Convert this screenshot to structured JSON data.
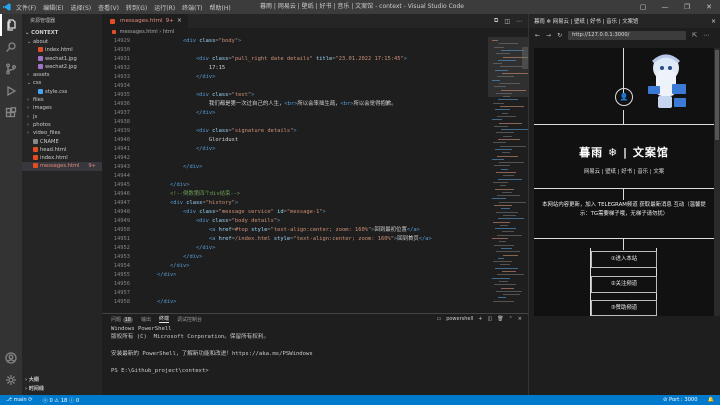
{
  "titlebar": {
    "menu": [
      "文件(F)",
      "编辑(E)",
      "选择(S)",
      "查看(V)",
      "转到(G)",
      "运行(R)",
      "终端(T)",
      "帮助(H)"
    ],
    "title": "暮雨 | 网易云 | 壁纸 | 好书 | 音乐 | 文案馆 - context - Visual Studio Code"
  },
  "sidebar": {
    "title": "资源管理器",
    "section": "CONTEXT",
    "items": [
      {
        "label": "about",
        "type": "folder",
        "open": true,
        "indent": 1
      },
      {
        "label": "index.html",
        "type": "html",
        "indent": 2
      },
      {
        "label": "wechat1.jpg",
        "type": "img",
        "indent": 2
      },
      {
        "label": "wechat2.jpg",
        "type": "img",
        "indent": 2
      },
      {
        "label": "assets",
        "type": "folder",
        "open": false,
        "indent": 1
      },
      {
        "label": "css",
        "type": "folder",
        "open": true,
        "indent": 1
      },
      {
        "label": "style.css",
        "type": "css",
        "indent": 2
      },
      {
        "label": "files",
        "type": "folder",
        "open": false,
        "indent": 1
      },
      {
        "label": "images",
        "type": "folder",
        "open": false,
        "indent": 1
      },
      {
        "label": "js",
        "type": "folder",
        "open": false,
        "indent": 1
      },
      {
        "label": "photos",
        "type": "folder",
        "open": false,
        "indent": 1
      },
      {
        "label": "video_files",
        "type": "folder",
        "open": false,
        "indent": 1
      },
      {
        "label": "CNAME",
        "type": "file",
        "indent": 1
      },
      {
        "label": "head.html",
        "type": "html",
        "indent": 1
      },
      {
        "label": "index.html",
        "type": "html",
        "indent": 1
      },
      {
        "label": "messages.html",
        "type": "html",
        "indent": 1,
        "modified": true,
        "badge": "9+"
      }
    ],
    "outline": "大纲",
    "timeline": "时间线"
  },
  "editor": {
    "tab_label": "messages.html",
    "tab_badge": "9+",
    "breadcrumb": [
      "messages.html",
      "html"
    ],
    "lines": [
      {
        "n": "14929",
        "segs": [
          [
            "p",
            "            "
          ],
          [
            "tg",
            "<div"
          ],
          [
            "p",
            " "
          ],
          [
            "at",
            "class"
          ],
          [
            "pun",
            "="
          ],
          [
            "st",
            "\"body\""
          ],
          [
            "tg",
            ">"
          ]
        ]
      },
      {
        "n": "14930",
        "segs": [
          [
            "p",
            ""
          ]
        ]
      },
      {
        "n": "14931",
        "segs": [
          [
            "p",
            "                "
          ],
          [
            "tg",
            "<div"
          ],
          [
            "p",
            " "
          ],
          [
            "at",
            "class"
          ],
          [
            "pun",
            "="
          ],
          [
            "st",
            "\"pull_right date details\""
          ],
          [
            "p",
            " "
          ],
          [
            "at",
            "title"
          ],
          [
            "pun",
            "="
          ],
          [
            "st",
            "\"23.01.2022 17:15:45\""
          ],
          [
            "tg",
            ">"
          ]
        ]
      },
      {
        "n": "14932",
        "segs": [
          [
            "ct",
            "                    17:15"
          ]
        ]
      },
      {
        "n": "14933",
        "segs": [
          [
            "p",
            "                "
          ],
          [
            "tg",
            "</div>"
          ]
        ]
      },
      {
        "n": "14934",
        "segs": [
          [
            "p",
            ""
          ]
        ]
      },
      {
        "n": "14935",
        "segs": [
          [
            "p",
            "                "
          ],
          [
            "tg",
            "<div"
          ],
          [
            "p",
            " "
          ],
          [
            "at",
            "class"
          ],
          [
            "pun",
            "="
          ],
          [
            "st",
            "\"text\""
          ],
          [
            "tg",
            ">"
          ]
        ]
      },
      {
        "n": "14936",
        "segs": [
          [
            "ct",
            "                    我们都是第一次过自己的人生，"
          ],
          [
            "tg",
            "<br>"
          ],
          [
            "ct",
            "所以会笨拙生疏，"
          ],
          [
            "tg",
            "<br>"
          ],
          [
            "ct",
            "所以会觉得抱歉。"
          ]
        ]
      },
      {
        "n": "14937",
        "segs": [
          [
            "p",
            "                "
          ],
          [
            "tg",
            "</div>"
          ]
        ]
      },
      {
        "n": "14938",
        "segs": [
          [
            "p",
            ""
          ]
        ]
      },
      {
        "n": "14939",
        "segs": [
          [
            "p",
            "                "
          ],
          [
            "tg",
            "<div"
          ],
          [
            "p",
            " "
          ],
          [
            "at",
            "class"
          ],
          [
            "pun",
            "="
          ],
          [
            "st",
            "\"signature details\""
          ],
          [
            "tg",
            ">"
          ]
        ]
      },
      {
        "n": "14940",
        "segs": [
          [
            "ct",
            "                    Gloridust"
          ]
        ]
      },
      {
        "n": "14941",
        "segs": [
          [
            "p",
            "                "
          ],
          [
            "tg",
            "</div>"
          ]
        ]
      },
      {
        "n": "14942",
        "segs": [
          [
            "p",
            ""
          ]
        ]
      },
      {
        "n": "14943",
        "segs": [
          [
            "p",
            "            "
          ],
          [
            "tg",
            "</div>"
          ]
        ]
      },
      {
        "n": "14944",
        "segs": [
          [
            "p",
            ""
          ]
        ]
      },
      {
        "n": "14945",
        "segs": [
          [
            "p",
            "        "
          ],
          [
            "tg",
            "</div>"
          ]
        ]
      },
      {
        "n": "14946",
        "segs": [
          [
            "p",
            "        "
          ],
          [
            "cm",
            "<!--倒数第四个div结束-->"
          ]
        ]
      },
      {
        "n": "14947",
        "segs": [
          [
            "p",
            "        "
          ],
          [
            "tg",
            "<div"
          ],
          [
            "p",
            " "
          ],
          [
            "at",
            "class"
          ],
          [
            "pun",
            "="
          ],
          [
            "st",
            "\"history\""
          ],
          [
            "tg",
            ">"
          ]
        ]
      },
      {
        "n": "14948",
        "segs": [
          [
            "p",
            "            "
          ],
          [
            "tg",
            "<div"
          ],
          [
            "p",
            " "
          ],
          [
            "at",
            "class"
          ],
          [
            "pun",
            "="
          ],
          [
            "st",
            "\"message service\""
          ],
          [
            "p",
            " "
          ],
          [
            "at",
            "id"
          ],
          [
            "pun",
            "="
          ],
          [
            "st",
            "\"message-1\""
          ],
          [
            "tg",
            ">"
          ]
        ]
      },
      {
        "n": "14949",
        "segs": [
          [
            "p",
            "                "
          ],
          [
            "tg",
            "<div"
          ],
          [
            "p",
            " "
          ],
          [
            "at",
            "class"
          ],
          [
            "pun",
            "="
          ],
          [
            "st",
            "\"body details\""
          ],
          [
            "tg",
            ">"
          ]
        ]
      },
      {
        "n": "14950",
        "segs": [
          [
            "p",
            "                    "
          ],
          [
            "tg",
            "<a"
          ],
          [
            "p",
            " "
          ],
          [
            "at",
            "href"
          ],
          [
            "pun",
            "="
          ],
          [
            "st",
            "#top"
          ],
          [
            "p",
            " "
          ],
          [
            "at",
            "style"
          ],
          [
            "pun",
            "="
          ],
          [
            "st",
            "\"text-align:center; zoom: 160%\""
          ],
          [
            "tg",
            ">"
          ],
          [
            "ct",
            "回到最初位置"
          ],
          [
            "tg",
            "</a>"
          ]
        ]
      },
      {
        "n": "14951",
        "segs": [
          [
            "p",
            "                    "
          ],
          [
            "tg",
            "<a"
          ],
          [
            "p",
            " "
          ],
          [
            "at",
            "href"
          ],
          [
            "pun",
            "="
          ],
          [
            "st",
            "/index.html"
          ],
          [
            "p",
            " "
          ],
          [
            "at",
            "style"
          ],
          [
            "pun",
            "="
          ],
          [
            "st",
            "\"text-align:center; zoom: 160%\""
          ],
          [
            "tg",
            ">"
          ],
          [
            "ct",
            "回到首页"
          ],
          [
            "tg",
            "</a>"
          ]
        ]
      },
      {
        "n": "14952",
        "segs": [
          [
            "p",
            "                "
          ],
          [
            "tg",
            "</div>"
          ]
        ]
      },
      {
        "n": "14953",
        "segs": [
          [
            "p",
            "            "
          ],
          [
            "tg",
            "</div>"
          ]
        ]
      },
      {
        "n": "14954",
        "segs": [
          [
            "p",
            "        "
          ],
          [
            "tg",
            "</div>"
          ]
        ]
      },
      {
        "n": "14955",
        "segs": [
          [
            "p",
            "    "
          ],
          [
            "tg",
            "</div>"
          ]
        ]
      },
      {
        "n": "14956",
        "segs": [
          [
            "p",
            ""
          ]
        ]
      },
      {
        "n": "14957",
        "segs": [
          [
            "p",
            ""
          ]
        ]
      },
      {
        "n": "14958",
        "segs": [
          [
            "p",
            "    "
          ],
          [
            "tg",
            "</div>"
          ]
        ]
      }
    ]
  },
  "panel": {
    "tabs": [
      "问题",
      "输出",
      "终端",
      "调试控制台"
    ],
    "problems_count": "18",
    "active_tab": "终端",
    "shell": "powershell",
    "terminal_lines": [
      "Windows PowerShell",
      "版权所有 (C)  Microsoft Corporation。保留所有权利。",
      "",
      "安装最新的 PowerShell，了解新功能和改进！https://aka.ms/PSWindows",
      "",
      "PS E:\\Github_project\\context>"
    ]
  },
  "browser": {
    "tab_title": "暮雨 ❄ 网易云 | 壁纸 | 好书 | 音乐 | 文案馆",
    "url": "http://127.0.0.1:3000/",
    "site_title": "暮雨 ❄ | 文案馆",
    "site_nav": "网易云 | 壁纸 | 好书 | 音乐 | 文案",
    "notice": "本网站内容更新，加入 TELEGRAM频道 获取最新消息 互动（温馨提示：TG需要梯子哦，无梯子请勿扰）",
    "buttons": [
      "①进入本站",
      "②关注频道",
      "③赞助频道"
    ]
  },
  "status": {
    "branch": "main",
    "errors": "0",
    "warnings": "18",
    "info": "0",
    "port": "Port : 3000"
  },
  "colors": {
    "accent": "#007acc",
    "modified": "#e58b7a"
  }
}
